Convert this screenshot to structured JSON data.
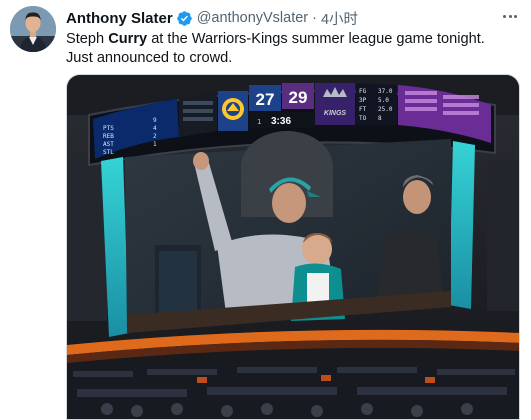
{
  "tweet": {
    "author": {
      "display_name": "Anthony Slater",
      "handle": "@anthonyVslater",
      "verified": true,
      "avatar_icon": "person-avatar-icon"
    },
    "separator": "·",
    "time": "4小时",
    "text": {
      "before": "Steph ",
      "bold": "Curry",
      "after": " at the Warriors-Kings summer league game tonight. Just announced to crowd."
    },
    "more_icon": "more-options-icon",
    "accent_color": "#1d9bf0"
  },
  "media": {
    "description_free": true,
    "scoreboard": {
      "home_score": "27",
      "away_score": "29",
      "clock": "3:36",
      "period": "1",
      "away_logo_text": "KINGS",
      "home_logo_icon": "warriors-logo-icon",
      "left_rows": [
        {
          "label": "PTS",
          "value": "9"
        },
        {
          "label": "REB",
          "value": "4"
        },
        {
          "label": "AST",
          "value": "2"
        },
        {
          "label": "STL",
          "value": "1"
        }
      ],
      "right_rows": [
        {
          "label": "FG",
          "value": "37.0"
        },
        {
          "label": "3P",
          "value": "5.0"
        },
        {
          "label": "FT",
          "value": "25.0"
        },
        {
          "label": "TO",
          "value": "8"
        }
      ],
      "colors": {
        "warriors_blue": "#1d428a",
        "warriors_gold": "#ffc72c",
        "kings_purple": "#5a2d81",
        "led_teal": "#2ec4c4"
      }
    }
  }
}
